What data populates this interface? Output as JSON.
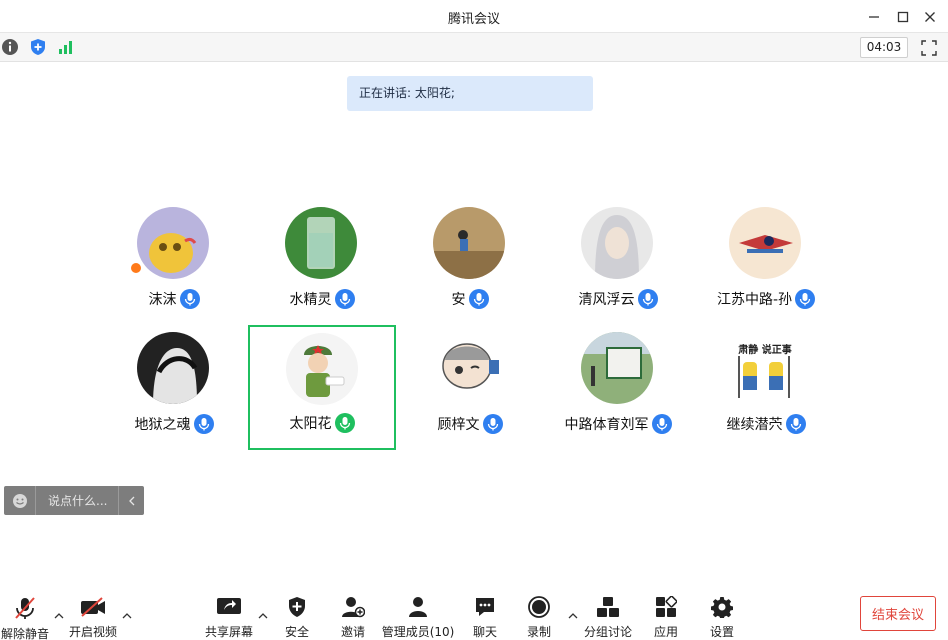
{
  "window": {
    "title": "腾讯会议"
  },
  "infobar": {
    "timer": "04:03"
  },
  "speaking_banner": "正在讲话: 太阳花;",
  "participants": [
    {
      "name": "沫沫",
      "mic": "on",
      "host": true
    },
    {
      "name": "水精灵",
      "mic": "on"
    },
    {
      "name": "安",
      "mic": "on"
    },
    {
      "name": "清风浮云",
      "mic": "on"
    },
    {
      "name": "江苏中路-孙",
      "mic": "on"
    },
    {
      "name": "地狱之魂",
      "mic": "on"
    },
    {
      "name": "太阳花",
      "mic": "speaking"
    },
    {
      "name": "顾梓文",
      "mic": "on"
    },
    {
      "name": "中路体育刘军",
      "mic": "on"
    },
    {
      "name": "继续潜茓",
      "mic": "on",
      "avatar_text": "肃静 说正事"
    }
  ],
  "chat": {
    "placeholder": "说点什么..."
  },
  "toolbar": {
    "unmute": "解除静音",
    "video": "开启视频",
    "share": "共享屏幕",
    "security": "安全",
    "invite": "邀请",
    "members": "管理成员(10)",
    "chat": "聊天",
    "record": "录制",
    "breakout": "分组讨论",
    "apps": "应用",
    "settings": "设置",
    "end": "结束会议"
  },
  "colors": {
    "accent_blue": "#2f7ff0",
    "speaking_green": "#1fbf5f",
    "end_red": "#e0453b",
    "banner_bg": "#dbe9fb"
  }
}
